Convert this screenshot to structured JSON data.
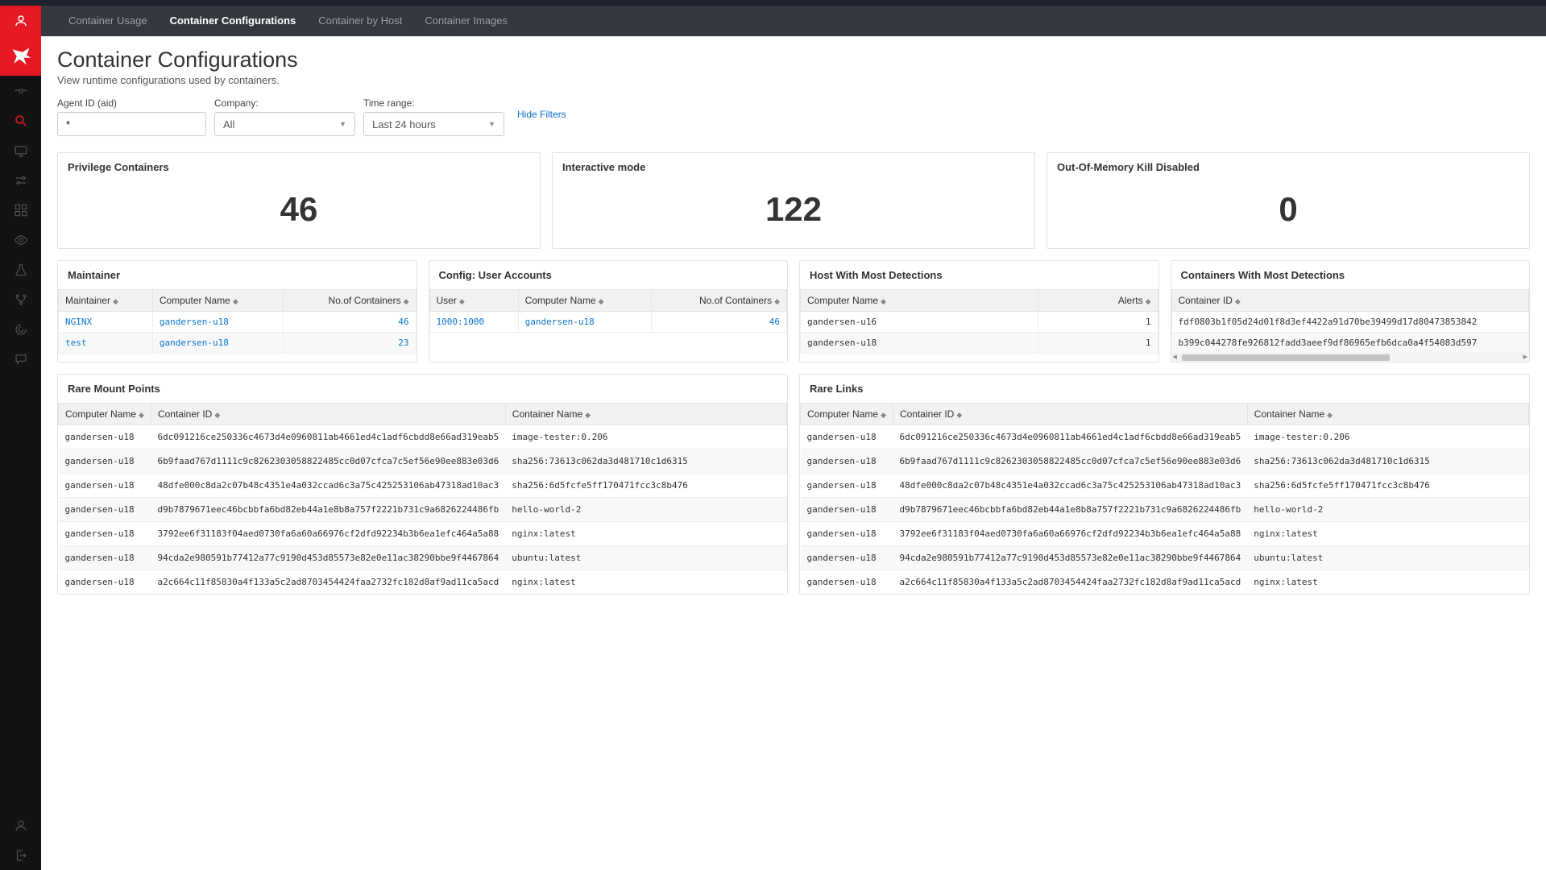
{
  "tabs": [
    "Container Usage",
    "Container Configurations",
    "Container by Host",
    "Container Images"
  ],
  "active_tab": 1,
  "page": {
    "title": "Container Configurations",
    "subtitle": "View runtime configurations used by containers."
  },
  "filters": {
    "agent_label": "Agent ID (aid)",
    "agent_value": "*",
    "company_label": "Company:",
    "company_value": "All",
    "time_label": "Time range:",
    "time_value": "Last 24 hours",
    "hide_filters": "Hide Filters"
  },
  "kpi": {
    "privilege_title": "Privilege Containers",
    "privilege_value": "46",
    "interactive_title": "Interactive mode",
    "interactive_value": "122",
    "oom_title": "Out-Of-Memory Kill Disabled",
    "oom_value": "0"
  },
  "maintainer": {
    "title": "Maintainer",
    "cols": [
      "Maintainer",
      "Computer Name",
      "No.of Containers"
    ],
    "rows": [
      {
        "m": "NGINX",
        "cn": "gandersen-u18",
        "n": "46"
      },
      {
        "m": "test",
        "cn": "gandersen-u18",
        "n": "23"
      }
    ]
  },
  "config_user": {
    "title": "Config: User Accounts",
    "cols": [
      "User",
      "Computer Name",
      "No.of Containers"
    ],
    "rows": [
      {
        "u": "1000:1000",
        "cn": "gandersen-u18",
        "n": "46"
      }
    ]
  },
  "host_det": {
    "title": "Host With Most Detections",
    "cols": [
      "Computer Name",
      "Alerts"
    ],
    "rows": [
      {
        "cn": "gandersen-u16",
        "a": "1"
      },
      {
        "cn": "gandersen-u18",
        "a": "1"
      }
    ]
  },
  "cont_det": {
    "title": "Containers With Most Detections",
    "cols": [
      "Container ID"
    ],
    "rows": [
      {
        "id": "fdf0803b1f05d24d01f8d3ef4422a91d70be39499d17d80473853842"
      },
      {
        "id": "b399c044278fe926812fadd3aeef9df86965efb6dca0a4f54083d597"
      }
    ]
  },
  "rare_mounts": {
    "title": "Rare Mount Points",
    "cols": [
      "Computer Name",
      "Container ID",
      "Container Name"
    ],
    "rows": [
      {
        "cn": "gandersen-u18",
        "id": "6dc091216ce250336c4673d4e0960811ab4661ed4c1adf6cbdd8e66ad319eab5",
        "name": "image-tester:0.206"
      },
      {
        "cn": "gandersen-u18",
        "id": "6b9faad767d1111c9c8262303058822485cc0d07cfca7c5ef56e90ee883e03d6",
        "name": "sha256:73613c062da3d481710c1d6315"
      },
      {
        "cn": "gandersen-u18",
        "id": "48dfe000c8da2c07b48c4351e4a032ccad6c3a75c425253106ab47318ad10ac3",
        "name": "sha256:6d5fcfe5ff170471fcc3c8b476"
      },
      {
        "cn": "gandersen-u18",
        "id": "d9b7879671eec46bcbbfa6bd82eb44a1e8b8a757f2221b731c9a6826224486fb",
        "name": "hello-world-2"
      },
      {
        "cn": "gandersen-u18",
        "id": "3792ee6f31183f04aed0730fa6a60a66976cf2dfd92234b3b6ea1efc464a5a88",
        "name": "nginx:latest"
      },
      {
        "cn": "gandersen-u18",
        "id": "94cda2e980591b77412a77c9190d453d85573e82e0e11ac38290bbe9f4467864",
        "name": "ubuntu:latest"
      },
      {
        "cn": "gandersen-u18",
        "id": "a2c664c11f85830a4f133a5c2ad8703454424faa2732fc182d8af9ad11ca5acd",
        "name": "nginx:latest"
      }
    ]
  },
  "rare_links": {
    "title": "Rare Links",
    "cols": [
      "Computer Name",
      "Container ID",
      "Container Name"
    ],
    "rows": [
      {
        "cn": "gandersen-u18",
        "id": "6dc091216ce250336c4673d4e0960811ab4661ed4c1adf6cbdd8e66ad319eab5",
        "name": "image-tester:0.206"
      },
      {
        "cn": "gandersen-u18",
        "id": "6b9faad767d1111c9c8262303058822485cc0d07cfca7c5ef56e90ee883e03d6",
        "name": "sha256:73613c062da3d481710c1d6315"
      },
      {
        "cn": "gandersen-u18",
        "id": "48dfe000c8da2c07b48c4351e4a032ccad6c3a75c425253106ab47318ad10ac3",
        "name": "sha256:6d5fcfe5ff170471fcc3c8b476"
      },
      {
        "cn": "gandersen-u18",
        "id": "d9b7879671eec46bcbbfa6bd82eb44a1e8b8a757f2221b731c9a6826224486fb",
        "name": "hello-world-2"
      },
      {
        "cn": "gandersen-u18",
        "id": "3792ee6f31183f04aed0730fa6a60a66976cf2dfd92234b3b6ea1efc464a5a88",
        "name": "nginx:latest"
      },
      {
        "cn": "gandersen-u18",
        "id": "94cda2e980591b77412a77c9190d453d85573e82e0e11ac38290bbe9f4467864",
        "name": "ubuntu:latest"
      },
      {
        "cn": "gandersen-u18",
        "id": "a2c664c11f85830a4f133a5c2ad8703454424faa2732fc182d8af9ad11ca5acd",
        "name": "nginx:latest"
      }
    ]
  }
}
